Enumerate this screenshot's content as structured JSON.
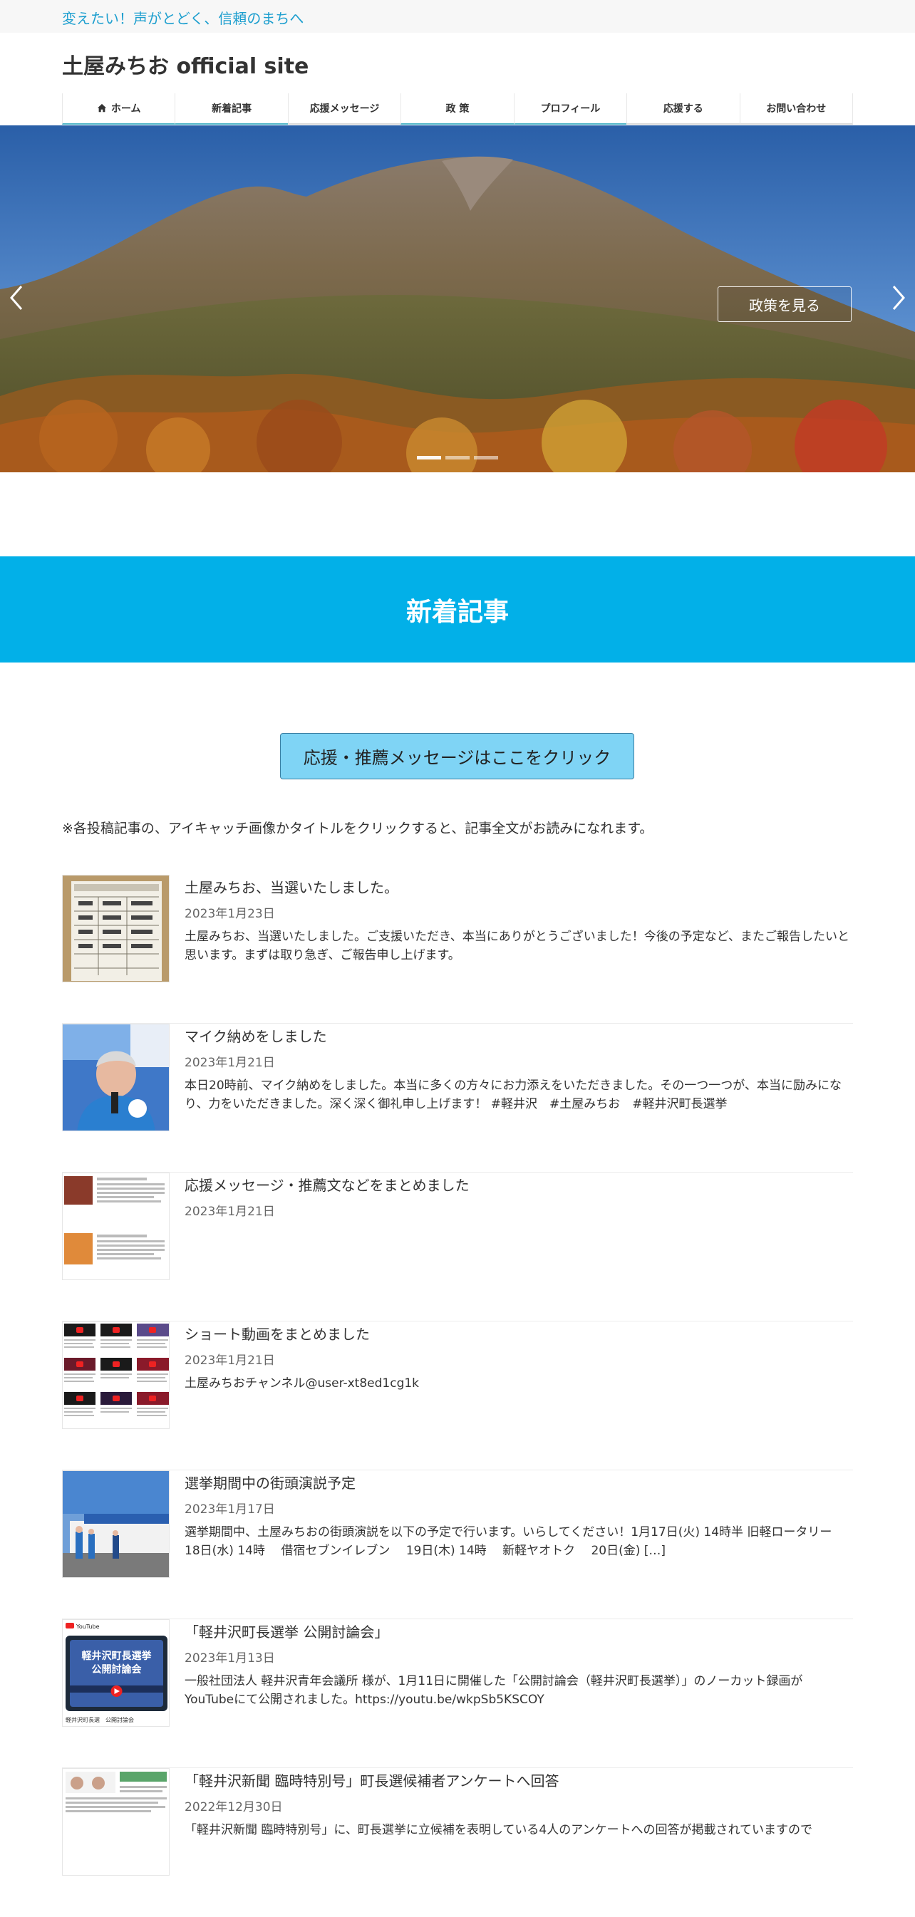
{
  "header": {
    "tagline": "変えたい！声がとどく、信頼のまちへ",
    "site_title": "土屋みちお official site"
  },
  "nav": {
    "items": [
      {
        "label": "ホーム",
        "icon": "home-icon"
      },
      {
        "label": "新着記事"
      },
      {
        "label": "応援メッセージ"
      },
      {
        "label": "政 策"
      },
      {
        "label": "プロフィール"
      },
      {
        "label": "応援する"
      },
      {
        "label": "お問い合わせ"
      }
    ]
  },
  "hero": {
    "button_label": "政策を見る",
    "slide_count": 3,
    "active_slide": 1
  },
  "section": {
    "title": "新着記事"
  },
  "cta": {
    "label": "応援・推薦メッセージはここをクリック"
  },
  "note": "※各投稿記事の、アイキャッチ画像かタイトルをクリックすると、記事全文がお読みになれます。",
  "thumb_text": {
    "youtube": "YouTube",
    "slide_line1": "軽井沢町長選挙",
    "slide_line2": "公開討論会",
    "caption": "軽井沢町長選　公開討論会"
  },
  "posts": [
    {
      "title": "土屋みちお、当選いたしました。",
      "date": "2023年1月23日",
      "excerpt": "土屋みちお、当選いたしました。ご支援いただき、本当にありがとうございました！今後の予定など、またご報告したいと思います。まずは取り急ぎ、ご報告申し上げます。"
    },
    {
      "title": "マイク納めをしました",
      "date": "2023年1月21日",
      "excerpt": "本日20時前、マイク納めをしました。本当に多くの方々にお力添えをいただきました。その一つ一つが、本当に励みになり、力をいただきました。深く深く御礼申し上げます！ #軽井沢　#土屋みちお　#軽井沢町長選挙"
    },
    {
      "title": "応援メッセージ・推薦文などをまとめました",
      "date": "2023年1月21日",
      "excerpt": ""
    },
    {
      "title": "ショート動画をまとめました",
      "date": "2023年1月21日",
      "excerpt": "土屋みちおチャンネル@user-xt8ed1cg1k"
    },
    {
      "title": "選挙期間中の街頭演説予定",
      "date": "2023年1月17日",
      "excerpt": "選挙期間中、土屋みちおの街頭演説を以下の予定で行います。いらしてください！1月17日(火) 14時半 旧軽ロータリー　 18日(水) 14時　 借宿セブンイレブン　 19日(木) 14時　 新軽ヤオトク　 20日(金) […]"
    },
    {
      "title": "「軽井沢町長選挙 公開討論会」",
      "date": "2023年1月13日",
      "excerpt": "一般社団法人 軽井沢青年会議所 様が、1月11日に開催した「公開討論会（軽井沢町長選挙）」のノーカット録画がYouTubeにて公開されました。https://youtu.be/wkpSb5KSCOY"
    },
    {
      "title": "「軽井沢新聞 臨時特別号」町長選候補者アンケートへ回答",
      "date": "2022年12月30日",
      "excerpt": "「軽井沢新聞 臨時特別号」に、町長選挙に立候補を表明している4人のアンケートへの回答が掲載されていますので"
    }
  ],
  "colors": {
    "accent": "#02b0e8",
    "tagline": "#1e9fcf",
    "cta_bg": "#7fd4f5"
  }
}
